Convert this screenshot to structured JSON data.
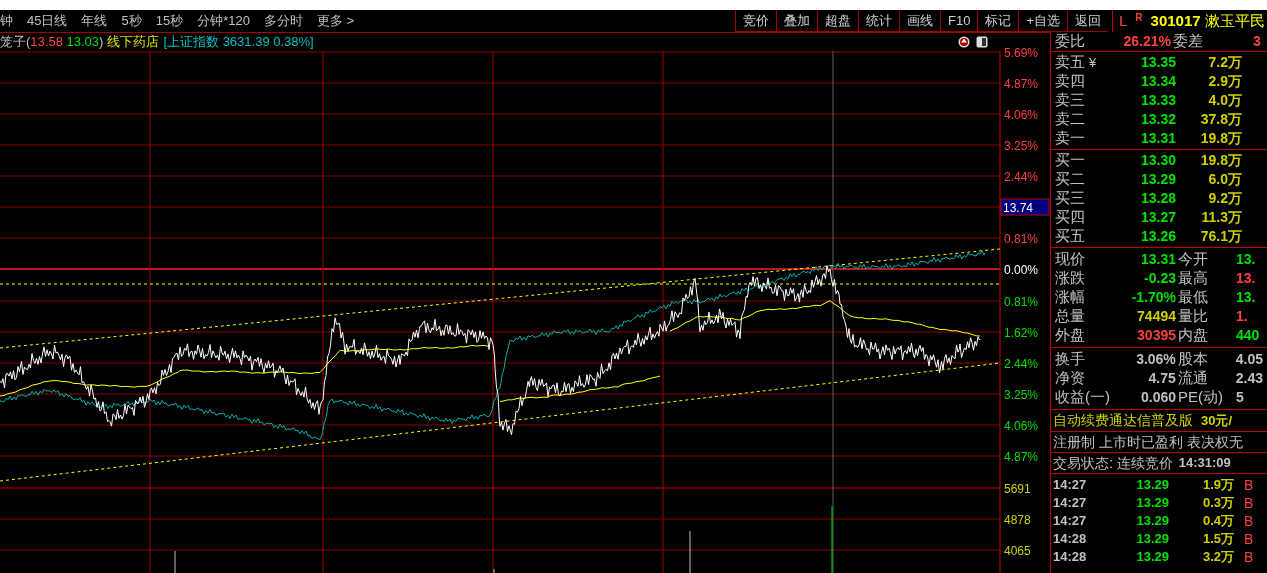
{
  "toolbar": {
    "periods": [
      "钟",
      "45日线",
      "年线",
      "5秒",
      "15秒",
      "分钟*120",
      "多分时",
      "更多 >"
    ],
    "buttons": [
      "竞价",
      "叠加",
      "超盘",
      "统计",
      "画线",
      "F10",
      "标记",
      "+自选",
      "返回"
    ]
  },
  "chart_header": {
    "name": "笼子(",
    "high": "13.58",
    "low": "13.03",
    "close": ")",
    "concept": "线下药店",
    "index": "[上证指数 3631.39 0.38%]"
  },
  "axis_labels": [
    {
      "text": "5.69%",
      "kind": "up"
    },
    {
      "text": "4.87%",
      "kind": "up"
    },
    {
      "text": "4.06%",
      "kind": "up"
    },
    {
      "text": "3.25%",
      "kind": "up"
    },
    {
      "text": "2.44%",
      "kind": "up"
    },
    {
      "text": "13.74",
      "kind": "tag"
    },
    {
      "text": "0.81%",
      "kind": "up"
    },
    {
      "text": "0.00%",
      "kind": "flat"
    },
    {
      "text": "0.81%",
      "kind": "down"
    },
    {
      "text": "1.62%",
      "kind": "down"
    },
    {
      "text": "2.44%",
      "kind": "down"
    },
    {
      "text": "3.25%",
      "kind": "down"
    },
    {
      "text": "4.06%",
      "kind": "down"
    },
    {
      "text": "4.87%",
      "kind": "down"
    },
    {
      "text": "5691",
      "kind": "volume"
    },
    {
      "text": "4878",
      "kind": "volume"
    },
    {
      "text": "4065",
      "kind": "volume"
    }
  ],
  "quote": {
    "market": "L",
    "flag": "R",
    "code": "301017",
    "name": "漱玉平民",
    "ratio_label": "委比",
    "ratio": "26.21%",
    "diff_label": "委差",
    "diff": "3",
    "asks": [
      {
        "label": "卖五",
        "mark": "¥",
        "price": "13.35",
        "volume": "7.2万"
      },
      {
        "label": "卖四",
        "price": "13.34",
        "volume": "2.9万"
      },
      {
        "label": "卖三",
        "price": "13.33",
        "volume": "4.0万"
      },
      {
        "label": "卖二",
        "price": "13.32",
        "volume": "37.8万"
      },
      {
        "label": "卖一",
        "price": "13.31",
        "volume": "19.8万"
      }
    ],
    "bids": [
      {
        "label": "买一",
        "price": "13.30",
        "volume": "19.8万"
      },
      {
        "label": "买二",
        "price": "13.29",
        "volume": "6.0万"
      },
      {
        "label": "买三",
        "price": "13.28",
        "volume": "9.2万"
      },
      {
        "label": "买四",
        "price": "13.27",
        "volume": "11.3万"
      },
      {
        "label": "买五",
        "price": "13.26",
        "volume": "76.1万"
      }
    ],
    "stats": [
      [
        {
          "label": "现价",
          "value": "13.31",
          "color": "#00e000"
        },
        {
          "label": "今开",
          "value": "13.",
          "color": "#00e000"
        }
      ],
      [
        {
          "label": "涨跌",
          "value": "-0.23",
          "color": "#00e000"
        },
        {
          "label": "最高",
          "value": "13.",
          "color": "#ff4040"
        }
      ],
      [
        {
          "label": "涨幅",
          "value": "-1.70%",
          "color": "#00e000"
        },
        {
          "label": "最低",
          "value": "13.",
          "color": "#00e000"
        }
      ],
      [
        {
          "label": "总量",
          "value": "74494",
          "color": "#d0d000"
        },
        {
          "label": "量比",
          "value": "1.",
          "color": "#ff4040"
        }
      ],
      [
        {
          "label": "外盘",
          "value": "30395",
          "color": "#ff4040"
        },
        {
          "label": "内盘",
          "value": "440",
          "color": "#00e000"
        }
      ]
    ],
    "fundamentals": [
      {
        "label": "换手",
        "value": "3.06%",
        "label2": "股本",
        "value2": "4.05"
      },
      {
        "label": "净资",
        "value": "4.75",
        "label2": "流通",
        "value2": "2.43"
      },
      {
        "label": "收益(一)",
        "value": "0.060",
        "label2": "PE(动)",
        "value2": "5"
      }
    ],
    "promo": "自动续费通达信普及版",
    "promo_price": "30元/",
    "notice": "注册制 上市时已盈利 表决权无",
    "status_label": "交易状态: 连续竞价",
    "status_time": "14:31:09",
    "trades": [
      {
        "time": "14:27",
        "price": "13.29",
        "volume": "1.9万",
        "side": "B"
      },
      {
        "time": "14:27",
        "price": "13.29",
        "volume": "0.3万",
        "side": "B"
      },
      {
        "time": "14:27",
        "price": "13.29",
        "volume": "0.4万",
        "side": "B"
      },
      {
        "time": "14:28",
        "price": "13.29",
        "volume": "1.5万",
        "side": "B"
      },
      {
        "time": "14:28",
        "price": "13.29",
        "volume": "3.2万",
        "side": "B"
      }
    ]
  }
}
